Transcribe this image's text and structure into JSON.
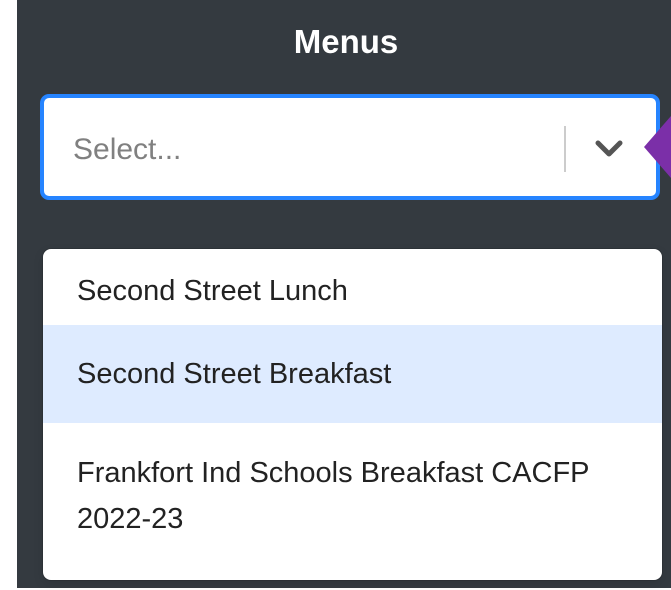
{
  "panel": {
    "title": "Menus",
    "background_color": "#343a40"
  },
  "select": {
    "placeholder": "Select...",
    "focus_color": "#2684ff",
    "indicator_icon": "chevron-down-icon",
    "pointer_icon": "arrow-pointer-icon",
    "pointer_color": "#7b2fa8"
  },
  "menu": {
    "options": [
      {
        "label": "Second Street Lunch",
        "highlighted": false
      },
      {
        "label": "Second Street Breakfast",
        "highlighted": true
      },
      {
        "label": "Frankfort Ind Schools Breakfast CACFP 2022-23",
        "highlighted": false
      }
    ],
    "highlight_color": "#deebff"
  }
}
